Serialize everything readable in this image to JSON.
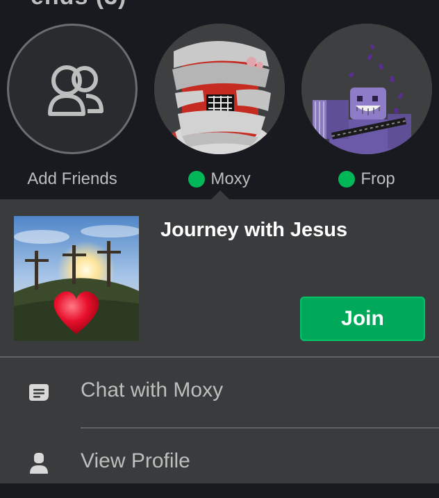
{
  "header": {
    "partial_title": "ends (3)"
  },
  "friends": [
    {
      "name": "Add Friends",
      "online": false
    },
    {
      "name": "Moxy",
      "online": true
    },
    {
      "name": "Frop",
      "online": true
    }
  ],
  "game": {
    "title": "Journey with Jesus",
    "join_label": "Join"
  },
  "menu": [
    {
      "label": "Chat with Moxy",
      "icon": "chat-icon"
    },
    {
      "label": "View Profile",
      "icon": "profile-icon"
    }
  ],
  "colors": {
    "online": "#02b757",
    "join": "#00a85a",
    "panel": "#393b3d",
    "background": "#191a1f"
  }
}
